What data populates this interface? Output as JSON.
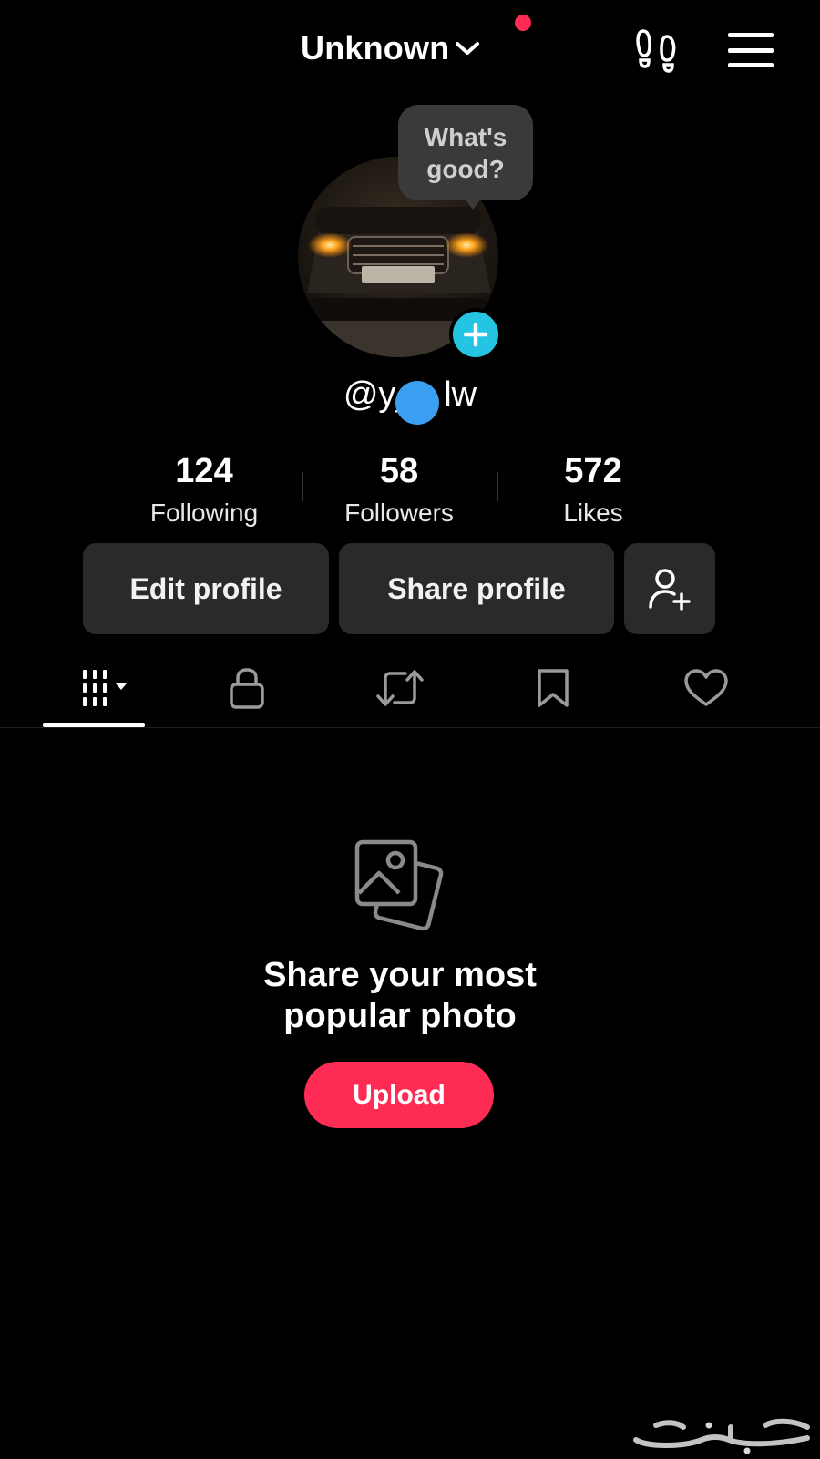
{
  "header": {
    "title": "Unknown",
    "title_dropdown_icon": "chevron-down-icon",
    "notification_dot_color": "#fe2c55",
    "footprint_icon": "footprint-icon",
    "menu_icon": "hamburger-menu-icon"
  },
  "profile": {
    "note_bubble": {
      "line1": "What's",
      "line2": "good?"
    },
    "add_icon": "plus-icon",
    "handle": "@y_   lw"
  },
  "stats": [
    {
      "value": "124",
      "label": "Following"
    },
    {
      "value": "58",
      "label": "Followers"
    },
    {
      "value": "572",
      "label": "Likes"
    }
  ],
  "actions": {
    "edit_label": "Edit profile",
    "share_label": "Share profile",
    "add_friend_icon": "add-user-icon"
  },
  "tabs": [
    {
      "icon": "videos-grid-icon",
      "active": true
    },
    {
      "icon": "lock-icon",
      "active": false
    },
    {
      "icon": "repost-icon",
      "active": false
    },
    {
      "icon": "bookmark-icon",
      "active": false
    },
    {
      "icon": "heart-icon",
      "active": false
    }
  ],
  "empty_state": {
    "icon": "photos-icon",
    "line1": "Share your most",
    "line2": "popular photo",
    "button_label": "Upload"
  },
  "colors": {
    "accent": "#fe2c55",
    "plus_badge": "#25c4e2",
    "button_bg": "#2a2a2a"
  }
}
